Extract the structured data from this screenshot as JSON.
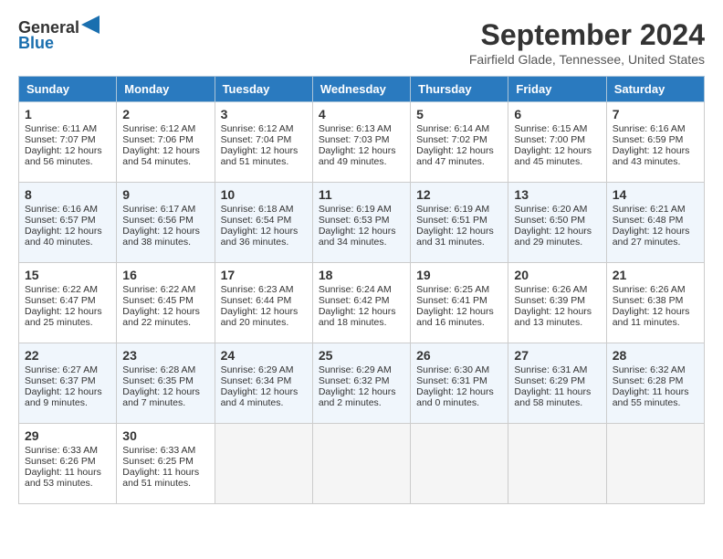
{
  "header": {
    "logo_line1": "General",
    "logo_line2": "Blue",
    "month": "September 2024",
    "location": "Fairfield Glade, Tennessee, United States"
  },
  "days_of_week": [
    "Sunday",
    "Monday",
    "Tuesday",
    "Wednesday",
    "Thursday",
    "Friday",
    "Saturday"
  ],
  "weeks": [
    [
      {
        "day": "1",
        "lines": [
          "Sunrise: 6:11 AM",
          "Sunset: 7:07 PM",
          "Daylight: 12 hours",
          "and 56 minutes."
        ]
      },
      {
        "day": "2",
        "lines": [
          "Sunrise: 6:12 AM",
          "Sunset: 7:06 PM",
          "Daylight: 12 hours",
          "and 54 minutes."
        ]
      },
      {
        "day": "3",
        "lines": [
          "Sunrise: 6:12 AM",
          "Sunset: 7:04 PM",
          "Daylight: 12 hours",
          "and 51 minutes."
        ]
      },
      {
        "day": "4",
        "lines": [
          "Sunrise: 6:13 AM",
          "Sunset: 7:03 PM",
          "Daylight: 12 hours",
          "and 49 minutes."
        ]
      },
      {
        "day": "5",
        "lines": [
          "Sunrise: 6:14 AM",
          "Sunset: 7:02 PM",
          "Daylight: 12 hours",
          "and 47 minutes."
        ]
      },
      {
        "day": "6",
        "lines": [
          "Sunrise: 6:15 AM",
          "Sunset: 7:00 PM",
          "Daylight: 12 hours",
          "and 45 minutes."
        ]
      },
      {
        "day": "7",
        "lines": [
          "Sunrise: 6:16 AM",
          "Sunset: 6:59 PM",
          "Daylight: 12 hours",
          "and 43 minutes."
        ]
      }
    ],
    [
      {
        "day": "8",
        "lines": [
          "Sunrise: 6:16 AM",
          "Sunset: 6:57 PM",
          "Daylight: 12 hours",
          "and 40 minutes."
        ]
      },
      {
        "day": "9",
        "lines": [
          "Sunrise: 6:17 AM",
          "Sunset: 6:56 PM",
          "Daylight: 12 hours",
          "and 38 minutes."
        ]
      },
      {
        "day": "10",
        "lines": [
          "Sunrise: 6:18 AM",
          "Sunset: 6:54 PM",
          "Daylight: 12 hours",
          "and 36 minutes."
        ]
      },
      {
        "day": "11",
        "lines": [
          "Sunrise: 6:19 AM",
          "Sunset: 6:53 PM",
          "Daylight: 12 hours",
          "and 34 minutes."
        ]
      },
      {
        "day": "12",
        "lines": [
          "Sunrise: 6:19 AM",
          "Sunset: 6:51 PM",
          "Daylight: 12 hours",
          "and 31 minutes."
        ]
      },
      {
        "day": "13",
        "lines": [
          "Sunrise: 6:20 AM",
          "Sunset: 6:50 PM",
          "Daylight: 12 hours",
          "and 29 minutes."
        ]
      },
      {
        "day": "14",
        "lines": [
          "Sunrise: 6:21 AM",
          "Sunset: 6:48 PM",
          "Daylight: 12 hours",
          "and 27 minutes."
        ]
      }
    ],
    [
      {
        "day": "15",
        "lines": [
          "Sunrise: 6:22 AM",
          "Sunset: 6:47 PM",
          "Daylight: 12 hours",
          "and 25 minutes."
        ]
      },
      {
        "day": "16",
        "lines": [
          "Sunrise: 6:22 AM",
          "Sunset: 6:45 PM",
          "Daylight: 12 hours",
          "and 22 minutes."
        ]
      },
      {
        "day": "17",
        "lines": [
          "Sunrise: 6:23 AM",
          "Sunset: 6:44 PM",
          "Daylight: 12 hours",
          "and 20 minutes."
        ]
      },
      {
        "day": "18",
        "lines": [
          "Sunrise: 6:24 AM",
          "Sunset: 6:42 PM",
          "Daylight: 12 hours",
          "and 18 minutes."
        ]
      },
      {
        "day": "19",
        "lines": [
          "Sunrise: 6:25 AM",
          "Sunset: 6:41 PM",
          "Daylight: 12 hours",
          "and 16 minutes."
        ]
      },
      {
        "day": "20",
        "lines": [
          "Sunrise: 6:26 AM",
          "Sunset: 6:39 PM",
          "Daylight: 12 hours",
          "and 13 minutes."
        ]
      },
      {
        "day": "21",
        "lines": [
          "Sunrise: 6:26 AM",
          "Sunset: 6:38 PM",
          "Daylight: 12 hours",
          "and 11 minutes."
        ]
      }
    ],
    [
      {
        "day": "22",
        "lines": [
          "Sunrise: 6:27 AM",
          "Sunset: 6:37 PM",
          "Daylight: 12 hours",
          "and 9 minutes."
        ]
      },
      {
        "day": "23",
        "lines": [
          "Sunrise: 6:28 AM",
          "Sunset: 6:35 PM",
          "Daylight: 12 hours",
          "and 7 minutes."
        ]
      },
      {
        "day": "24",
        "lines": [
          "Sunrise: 6:29 AM",
          "Sunset: 6:34 PM",
          "Daylight: 12 hours",
          "and 4 minutes."
        ]
      },
      {
        "day": "25",
        "lines": [
          "Sunrise: 6:29 AM",
          "Sunset: 6:32 PM",
          "Daylight: 12 hours",
          "and 2 minutes."
        ]
      },
      {
        "day": "26",
        "lines": [
          "Sunrise: 6:30 AM",
          "Sunset: 6:31 PM",
          "Daylight: 12 hours",
          "and 0 minutes."
        ]
      },
      {
        "day": "27",
        "lines": [
          "Sunrise: 6:31 AM",
          "Sunset: 6:29 PM",
          "Daylight: 11 hours",
          "and 58 minutes."
        ]
      },
      {
        "day": "28",
        "lines": [
          "Sunrise: 6:32 AM",
          "Sunset: 6:28 PM",
          "Daylight: 11 hours",
          "and 55 minutes."
        ]
      }
    ],
    [
      {
        "day": "29",
        "lines": [
          "Sunrise: 6:33 AM",
          "Sunset: 6:26 PM",
          "Daylight: 11 hours",
          "and 53 minutes."
        ]
      },
      {
        "day": "30",
        "lines": [
          "Sunrise: 6:33 AM",
          "Sunset: 6:25 PM",
          "Daylight: 11 hours",
          "and 51 minutes."
        ]
      },
      {
        "day": "",
        "lines": []
      },
      {
        "day": "",
        "lines": []
      },
      {
        "day": "",
        "lines": []
      },
      {
        "day": "",
        "lines": []
      },
      {
        "day": "",
        "lines": []
      }
    ]
  ]
}
